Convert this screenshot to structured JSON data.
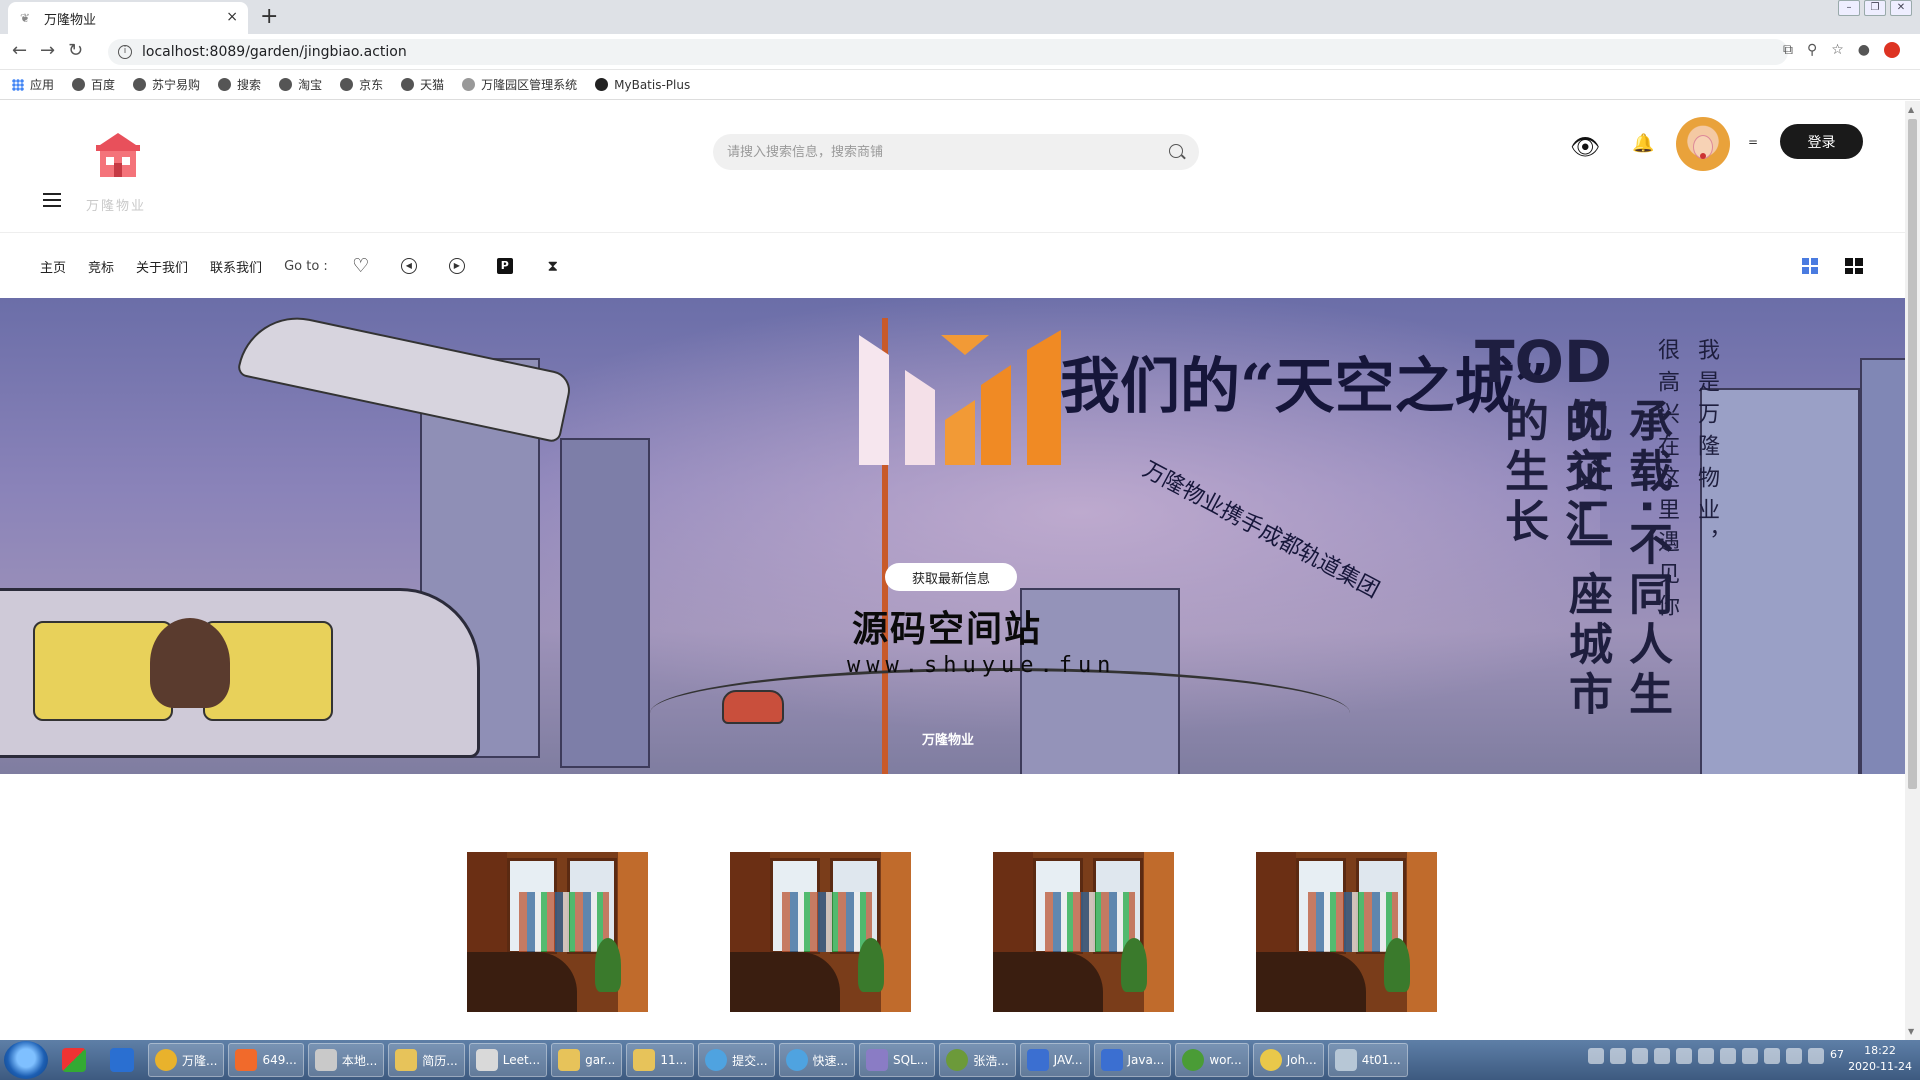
{
  "browser": {
    "tab_title": "万隆物业",
    "tab_close": "×",
    "new_tab": "+",
    "url": "localhost:8089/garden/jingbiao.action",
    "bookmarks": [
      "应用",
      "百度",
      "苏宁易购",
      "搜索",
      "淘宝",
      "京东",
      "天猫",
      "万隆园区管理系统",
      "MyBatis-Plus"
    ]
  },
  "header": {
    "logo_text": "万隆物业",
    "search_placeholder": "请搜入搜索信息，搜索商铺",
    "login_label": "登录",
    "user_menu_glyph": "="
  },
  "nav": {
    "items": [
      "主页",
      "竞标",
      "关于我们",
      "联系我们"
    ],
    "goto_label": "Go to :",
    "goto_icons": [
      "heart-icon",
      "clock-back-icon",
      "play-icon",
      "parking-icon",
      "hourglass-icon"
    ]
  },
  "hero": {
    "slogan_line1": "我们的“天空之城”",
    "subtitle_curve": "万隆物业携手成都轨道集团",
    "tod": "TOD",
    "col_a": "见证·一座城市的生长",
    "col_b": "承载·不同人生的交汇",
    "col_c": "很高兴在这里遇见你",
    "col_d": "我是万隆物业，",
    "cta_label": "获取最新信息",
    "watermark_text": "源码空间站",
    "watermark_url": "www.shuyue.fun",
    "caption": "万隆物业",
    "colors": {
      "sky": "#8a83b9",
      "accent_orange": "#f08a24"
    }
  },
  "gallery": {
    "items": [
      {
        "alt": "shop-photo"
      },
      {
        "alt": "shop-photo"
      },
      {
        "alt": "shop-photo"
      },
      {
        "alt": "shop-photo"
      }
    ]
  },
  "taskbar": {
    "buttons": [
      "万隆...",
      "649...",
      "本地...",
      "简历...",
      "Leet...",
      "gar...",
      "11...",
      "提交...",
      "快速...",
      "SQL...",
      "张浩...",
      "JAV...",
      "Java...",
      "wor...",
      "Joh...",
      "4t01..."
    ],
    "tray_count": "67",
    "time": "18:22",
    "date": "2020-11-24"
  }
}
